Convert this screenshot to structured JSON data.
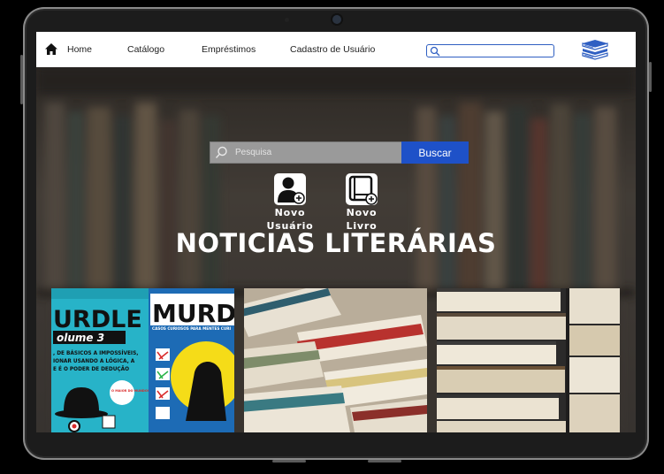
{
  "nav": {
    "items": [
      {
        "label": "Home"
      },
      {
        "label": "Catálogo"
      },
      {
        "label": "Empréstimos"
      },
      {
        "label": "Cadastro de Usuário"
      }
    ],
    "search_placeholder": ""
  },
  "hero": {
    "search_placeholder": "Pesquisa",
    "search_button": "Buscar",
    "quick_actions": [
      {
        "line1": "Novo",
        "line2": "Usuário",
        "icon": "add-user-icon"
      },
      {
        "line1": "Novo",
        "line2": "Livro",
        "icon": "add-book-icon"
      }
    ],
    "headline": "NOTICIAS LITERÁRIAS"
  },
  "cards": [
    {
      "cover_left_title": "URDLE",
      "cover_left_volume": "olume 3",
      "cover_left_lines": [
        ", DE BÁSICOS A IMPOSSÍVEIS,",
        "IONAR USANDO A LÓGICA, A",
        "E É O PODER DE DEDUÇÃO"
      ],
      "cover_left_badge": "O MAIOR DO MUNDO!",
      "cover_right_title": "MURD",
      "cover_right_subtitle": "CASOS CURIOSOS PARA MENTES CURI"
    },
    {
      "image": "stacked-books-photo"
    },
    {
      "image": "book-spines-photo"
    }
  ],
  "colors": {
    "accent": "#1e51c8",
    "navbar": "#ffffff",
    "frame": "#1c1c1c"
  }
}
